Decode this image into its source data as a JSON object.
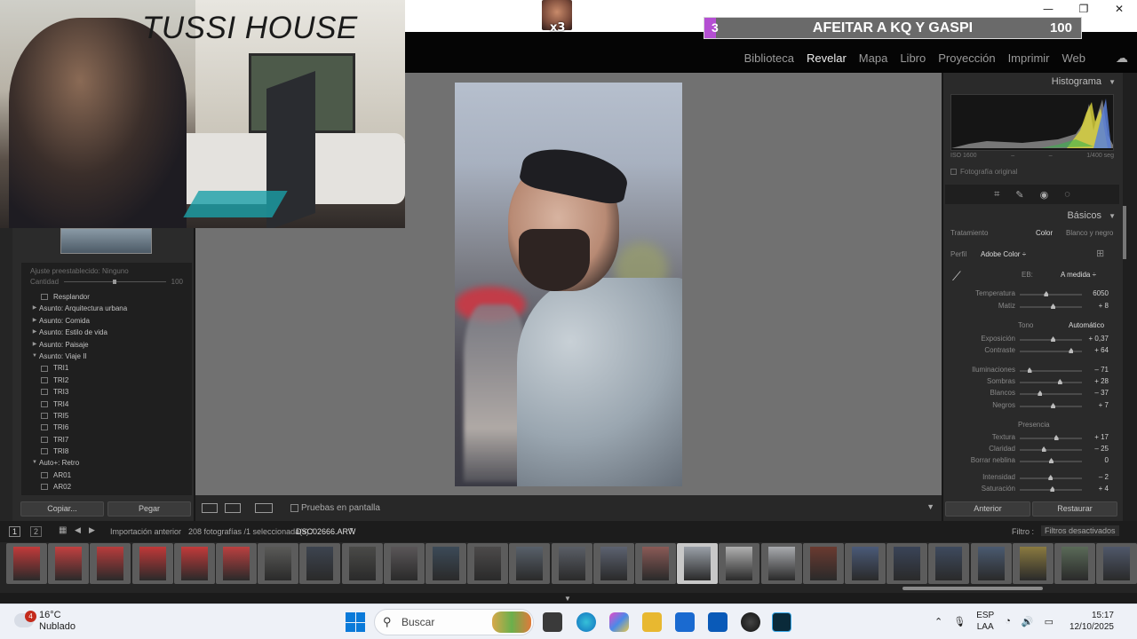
{
  "window": {
    "controls": [
      "—",
      "❐",
      "✕"
    ]
  },
  "stream": {
    "title": "TUSSI HOUSE",
    "avatar_count": "x3",
    "goal": {
      "current": "3",
      "title": "AFEITAR A KQ Y GASPI",
      "target": "100",
      "fraction": 0.03,
      "color": "#b44fd2"
    }
  },
  "modules": [
    "Biblioteca",
    "Revelar",
    "Mapa",
    "Libro",
    "Proyección",
    "Imprimir",
    "Web"
  ],
  "active_module": "Revelar",
  "left_panel": {
    "preset_header": "Ajuste preestablecido:  Ninguno",
    "amount_label": "Cantidad",
    "amount_value": "100",
    "presets": [
      {
        "label": "Resplandor",
        "kind": "preset"
      },
      {
        "label": "Asunto: Arquitectura urbana",
        "kind": "folder-closed"
      },
      {
        "label": "Asunto: Comida",
        "kind": "folder-closed"
      },
      {
        "label": "Asunto: Estilo de vida",
        "kind": "folder-closed"
      },
      {
        "label": "Asunto: Paisaje",
        "kind": "folder-closed"
      },
      {
        "label": "Asunto: Viaje II",
        "kind": "folder-open"
      },
      {
        "label": "TRI1",
        "kind": "preset"
      },
      {
        "label": "TRI2",
        "kind": "preset"
      },
      {
        "label": "TRI3",
        "kind": "preset"
      },
      {
        "label": "TRI4",
        "kind": "preset"
      },
      {
        "label": "TRI5",
        "kind": "preset"
      },
      {
        "label": "TRI6",
        "kind": "preset"
      },
      {
        "label": "TRI7",
        "kind": "preset"
      },
      {
        "label": "TRI8",
        "kind": "preset"
      },
      {
        "label": "Auto+: Retro",
        "kind": "folder-open"
      },
      {
        "label": "AR01",
        "kind": "preset"
      },
      {
        "label": "AR02",
        "kind": "preset"
      }
    ],
    "copy_label": "Copiar...",
    "paste_label": "Pegar"
  },
  "toolbar": {
    "proof_label": "Pruebas en pantalla"
  },
  "right_panel": {
    "histogram_title": "Histograma",
    "histo_iso": "ISO 1600",
    "histo_dash1": "–",
    "histo_dash2": "–",
    "histo_shutter": "1/400 seg",
    "original_photo": "Fotografía original",
    "basic_title": "Básicos",
    "treatment_label": "Tratamiento",
    "treatment_color": "Color",
    "treatment_bw": "Blanco y negro",
    "profile_label": "Perfil",
    "profile_value": "Adobe Color ÷",
    "wb_label": "EB:",
    "wb_value": "A medida ÷",
    "tone_label": "Tono",
    "auto_label": "Automático",
    "presence_label": "Presencia",
    "sliders": [
      {
        "label": "Temperatura",
        "value": "6050",
        "pos": 0.42
      },
      {
        "label": "Matiz",
        "value": "+ 8",
        "pos": 0.53
      },
      {
        "label": "Exposición",
        "value": "+ 0,37",
        "pos": 0.53
      },
      {
        "label": "Contraste",
        "value": "+ 64",
        "pos": 0.82
      },
      {
        "label": "Iluminaciones",
        "value": "– 71",
        "pos": 0.15
      },
      {
        "label": "Sombras",
        "value": "+ 28",
        "pos": 0.64
      },
      {
        "label": "Blancos",
        "value": "– 37",
        "pos": 0.32
      },
      {
        "label": "Negros",
        "value": "+ 7",
        "pos": 0.53
      },
      {
        "label": "Textura",
        "value": "+ 17",
        "pos": 0.58
      },
      {
        "label": "Claridad",
        "value": "– 25",
        "pos": 0.38
      },
      {
        "label": "Borrar neblina",
        "value": "0",
        "pos": 0.5
      },
      {
        "label": "Intensidad",
        "value": "– 2",
        "pos": 0.49
      },
      {
        "label": "Saturación",
        "value": "+ 4",
        "pos": 0.52
      }
    ],
    "prev_label": "Anterior",
    "reset_label": "Restaurar"
  },
  "filmstrip_bar": {
    "page1": "1",
    "page2": "2",
    "source": "Importación anterior",
    "count": "208 fotografías /1 seleccionada(s) /",
    "filename": "DSC02666.ARW",
    "filter_label": "Filtro :",
    "filter_value": "Filtros desactivados"
  },
  "filmstrip": {
    "thumb_colors": [
      "#c23a3a",
      "#c24040",
      "#b83c3c",
      "#c03838",
      "#c23a3a",
      "#bb4040",
      "#5a5a58",
      "#3d4450",
      "#4a4a48",
      "#5a5658",
      "#3c4a58",
      "#4c4a4a",
      "#58606a",
      "#5a5e66",
      "#5c6270",
      "#8a5a56",
      "#9aa0a8",
      "#b0b0b0",
      "#a8aaae",
      "#6a3a30",
      "#4a5a78",
      "#3a4458",
      "#3e4a5e",
      "#4a5a70",
      "#8a7a40",
      "#5a6a58",
      "#50586a"
    ],
    "selected_index": 16
  },
  "taskbar": {
    "weather_badge": "4",
    "temperature": "16°C",
    "condition": "Nublado",
    "search_placeholder": "Buscar",
    "lang1": "ESP",
    "lang2": "LAA",
    "time": "15:17",
    "date": "12/10/2025"
  }
}
